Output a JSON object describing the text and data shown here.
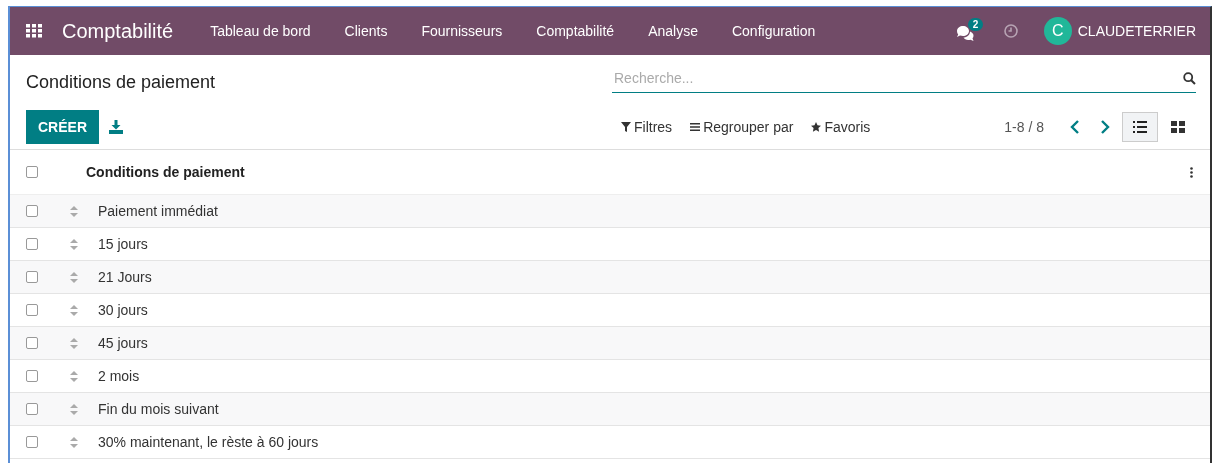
{
  "navbar": {
    "app_name": "Comptabilité",
    "menu": [
      "Tableau de bord",
      "Clients",
      "Fournisseurs",
      "Comptabilité",
      "Analyse",
      "Configuration"
    ],
    "messages_badge": "2",
    "user_initial": "C",
    "user_name": "CLAUDETERRIER"
  },
  "control_panel": {
    "title": "Conditions de paiement",
    "create_button": "CRÉER",
    "search": {
      "placeholder": "Recherche..."
    },
    "filters": [
      {
        "label": "Filtres",
        "kind": "filter"
      },
      {
        "label": "Regrouper par",
        "kind": "group"
      },
      {
        "label": "Favoris",
        "kind": "star"
      }
    ],
    "pager": "1-8 / 8",
    "views": [
      {
        "kind": "list",
        "selected": true
      },
      {
        "kind": "kanban",
        "selected": false
      }
    ]
  },
  "list": {
    "columns": [
      "Conditions de paiement"
    ],
    "header_checked": false,
    "rows": [
      {
        "name": "Paiement immédiat",
        "checked": false
      },
      {
        "name": "15 jours",
        "checked": false
      },
      {
        "name": "21 Jours",
        "checked": false
      },
      {
        "name": "30 jours",
        "checked": false
      },
      {
        "name": "45 jours",
        "checked": false
      },
      {
        "name": "2 mois",
        "checked": false
      },
      {
        "name": "Fin du mois suivant",
        "checked": false
      },
      {
        "name": "30% maintenant, le rèste à 60 jours",
        "checked": false
      }
    ]
  }
}
